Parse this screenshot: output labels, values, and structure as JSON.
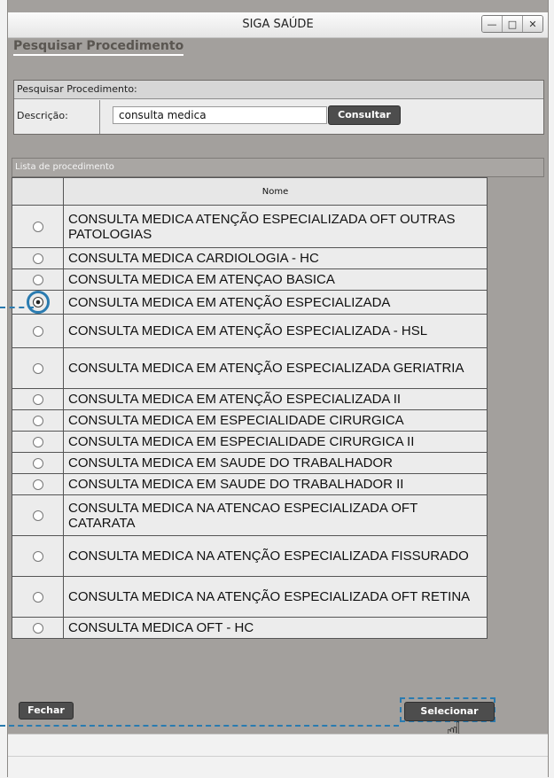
{
  "window": {
    "title": "SIGA SAÚDE"
  },
  "page": {
    "title": "Pesquisar Procedimento"
  },
  "search": {
    "header": "Pesquisar Procedimento:",
    "desc_label": "Descrição:",
    "desc_value": "consulta medica",
    "consult_button": "Consultar"
  },
  "list": {
    "header": "Lista de procedimento",
    "col_name": "Nome",
    "selected_index": 3,
    "rows": [
      "CONSULTA MEDICA ATENÇÃO ESPECIALIZADA OFT OUTRAS PATOLOGIAS",
      "CONSULTA MEDICA CARDIOLOGIA - HC",
      "CONSULTA MEDICA EM ATENÇAO BASICA",
      "CONSULTA MEDICA EM ATENÇÃO ESPECIALIZADA",
      "CONSULTA MEDICA EM ATENÇÃO ESPECIALIZADA - HSL",
      "CONSULTA MEDICA EM ATENÇÃO ESPECIALIZADA GERIATRIA",
      "CONSULTA MEDICA EM ATENÇÃO ESPECIALIZADA II",
      "CONSULTA MEDICA EM ESPECIALIDADE CIRURGICA",
      "CONSULTA MEDICA EM ESPECIALIDADE CIRURGICA II",
      "CONSULTA MEDICA EM SAUDE DO TRABALHADOR",
      "CONSULTA MEDICA EM SAUDE DO TRABALHADOR II",
      "CONSULTA MEDICA NA ATENCAO ESPECIALIZADA OFT CATARATA",
      "CONSULTA MEDICA NA ATENÇÃO ESPECIALIZADA FISSURADO",
      "CONSULTA MEDICA NA ATENÇÃO ESPECIALIZADA OFT RETINA",
      "CONSULTA MEDICA OFT - HC"
    ]
  },
  "footer": {
    "close_button": "Fechar",
    "select_button": "Selecionar"
  },
  "colors": {
    "accent": "#2a7bb0",
    "window_bg": "#a3a09d",
    "button_dark": "#4d4d4d"
  }
}
